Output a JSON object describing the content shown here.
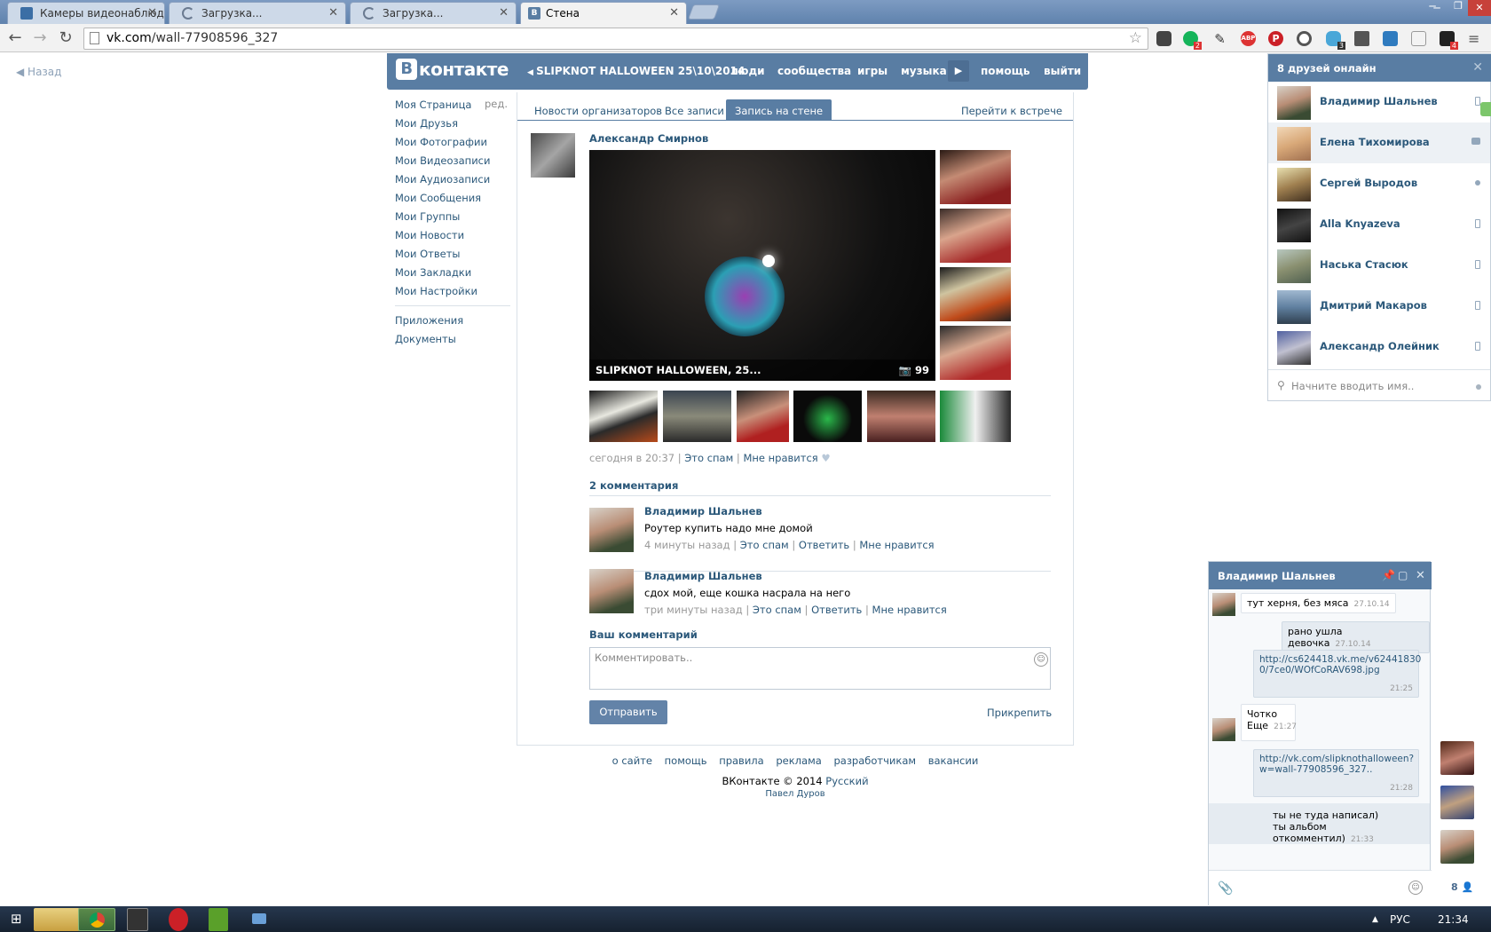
{
  "browser": {
    "tabs": [
      {
        "title": "Камеры видеонаблюден"
      },
      {
        "title": "Загрузка..."
      },
      {
        "title": "Загрузка..."
      },
      {
        "title": "Стена"
      }
    ],
    "url_prefix": "vk.com",
    "url_rest": "/wall-77908596_327",
    "badges": {
      "grammarly": "2",
      "ghost": "3",
      "mail": "4"
    }
  },
  "page": {
    "back_label": "Назад",
    "logo_text": "контакте",
    "logo_letter": "B",
    "topnav": {
      "playing": "SLIPKNOT HALLOWEEN 25\\10\\2014",
      "people": "люди",
      "communities": "сообщества",
      "games": "игры",
      "music": "музыка",
      "help": "помощь",
      "logout": "выйти"
    },
    "left_menu": {
      "edit": "ред.",
      "items": [
        "Моя Страница",
        "Мои Друзья",
        "Мои Фотографии",
        "Мои Видеозаписи",
        "Мои Аудиозаписи",
        "Мои Сообщения",
        "Мои Группы",
        "Мои Новости",
        "Мои Ответы",
        "Мои Закладки",
        "Мои Настройки"
      ],
      "extra": [
        "Приложения",
        "Документы"
      ]
    },
    "wall_tabs": [
      "Новости организаторов",
      "Все записи",
      "Запись на стене"
    ],
    "goto_event": "Перейти к встрече",
    "post": {
      "author": "Александр Смирнов",
      "album_caption": "SLIPKNOT HALLOWEEN, 25...",
      "photo_count": "99",
      "date": "сегодня в 20:37",
      "spam": "Это спам",
      "like": "Мне нравится"
    },
    "comments_title": "2 комментария",
    "comments": [
      {
        "author": "Владимир Шальнев",
        "text": "Роутер купить надо мне домой",
        "time": "4 минуты назад",
        "spam": "Это спам",
        "reply": "Ответить",
        "like": "Мне нравится"
      },
      {
        "author": "Владимир Шальнев",
        "text": "сдох мой, еще кошка насрала на него",
        "time": "три минуты назад",
        "spam": "Это спам",
        "reply": "Ответить",
        "like": "Мне нравится"
      }
    ],
    "your_comment": "Ваш комментарий",
    "comment_placeholder": "Комментировать..",
    "send": "Отправить",
    "attach": "Прикрепить",
    "footer": {
      "links": [
        "о сайте",
        "помощь",
        "правила",
        "реклама",
        "разработчикам",
        "вакансии"
      ],
      "copyright": "ВКонтакте © 2014",
      "language": "Русский",
      "durov": "Павел Дуров"
    }
  },
  "friends_panel": {
    "title": "8 друзей онлайн",
    "friends": [
      "Владимир Шальнев",
      "Елена Тихомирова",
      "Сергей Выродов",
      "Alla Knyazeva",
      "Наська Стасюк",
      "Дмитрий Макаров",
      "Александр Олейник"
    ],
    "search_placeholder": "Начните вводить имя.."
  },
  "chat": {
    "title": "Владимир Шальнев",
    "messages": [
      {
        "text": "тут херня, без мяса",
        "time": "27.10.14"
      },
      {
        "text": "рано ушла девочка",
        "time": "27.10.14"
      },
      {
        "text": "http://cs624418.vk.me/v62441830",
        "text2": "0/7ce0/WOfCoRAV698.jpg",
        "time": "21:25"
      },
      {
        "text": "Чотко",
        "text2": "Еще",
        "time": "21:27"
      },
      {
        "text": "http://vk.com/slipknothalloween?",
        "text2": "w=wall-77908596_327..",
        "time": "21:28"
      },
      {
        "text": "ты не туда написал)",
        "text2": "ты альбом откомментил)",
        "time": "21:33"
      }
    ],
    "online_count": "8"
  },
  "taskbar": {
    "lang": "РУС",
    "clock": "21:34"
  }
}
